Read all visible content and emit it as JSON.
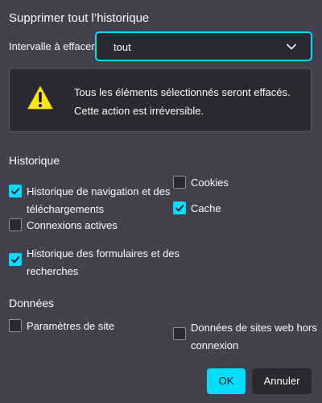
{
  "dialog": {
    "title": "Supprimer tout l’historique",
    "range_label": "Intervalle à effacer :",
    "range_value": "tout",
    "warning": {
      "line1": "Tous les éléments sélectionnés seront effacés.",
      "line2": "Cette action est irréversible."
    },
    "history_section": {
      "title": "Historique",
      "options": [
        {
          "line1": "Historique de navigation et des",
          "line2": "téléchargements",
          "checked": true
        },
        {
          "line1": "Cookies",
          "checked": false
        },
        {
          "line1": "Cache",
          "checked": true
        },
        {
          "line1": "Connexions actives",
          "checked": false
        },
        {
          "line1": "Historique des formulaires et des",
          "line2": "recherches",
          "checked": true
        }
      ]
    },
    "data_section": {
      "title": "Données",
      "options": [
        {
          "line1": "Paramètres de site",
          "checked": false
        },
        {
          "line1": "Données de sites web hors",
          "line2": "connexion",
          "checked": false
        }
      ]
    },
    "buttons": {
      "ok": "OK",
      "cancel": "Annuler"
    },
    "colors": {
      "background": "#42414d",
      "field": "#2b2a33",
      "accent": "#00ddff",
      "text": "#fbfbfe"
    }
  }
}
